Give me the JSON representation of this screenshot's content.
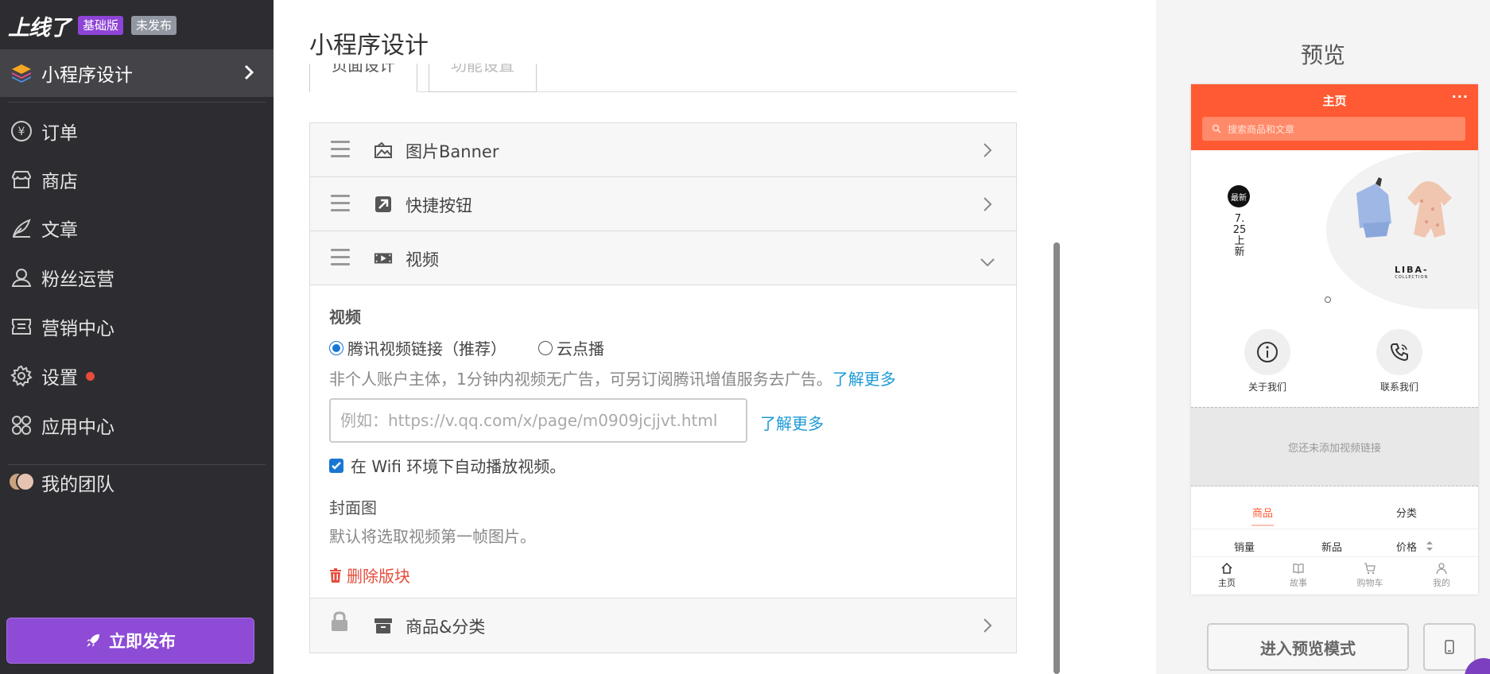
{
  "sidebar": {
    "brand": "上线了",
    "plan_badge": "基础版",
    "status_badge": "未发布",
    "active_item": "小程序设计",
    "items": [
      {
        "label": "订单"
      },
      {
        "label": "商店"
      },
      {
        "label": "文章"
      },
      {
        "label": "粉丝运营"
      },
      {
        "label": "营销中心"
      },
      {
        "label": "设置"
      },
      {
        "label": "应用中心"
      }
    ],
    "team": "我的团队",
    "publish_label": "立即发布"
  },
  "main": {
    "title": "小程序设计",
    "tabs": [
      "页面设计",
      "功能设置"
    ],
    "blocks": {
      "banner": "图片Banner",
      "shortcut": "快捷按钮",
      "video": "视频",
      "products": "商品&分类"
    },
    "video": {
      "section_title": "视频",
      "option_tencent": "腾讯视频链接（推荐）",
      "option_cloud": "云点播",
      "notice": "非个人账户主体，1分钟内视频无广告，可另订阅腾讯增值服务去广告。",
      "learn_more": "了解更多",
      "url_placeholder": "例如：https://v.qq.com/x/page/m0909jcjjvt.html",
      "learn_more_2": "了解更多",
      "autoplay": "在 Wifi 环境下自动播放视频。",
      "cover_title": "封面图",
      "cover_hint": "默认将选取视频第一帧图片。",
      "delete": "删除版块"
    }
  },
  "preview": {
    "title": "预览",
    "phone": {
      "header_title": "主页",
      "more": "···",
      "search_placeholder": "搜索商品和文章",
      "banner_badge": "最新",
      "banner_text": "7.25上新",
      "banner_brand": "LIBA-",
      "banner_brand_sub": "COLLECTION",
      "quick_about": "关于我们",
      "quick_contact": "联系我们",
      "video_placeholder": "您还未添加视频链接",
      "tab_products": "商品",
      "tab_categories": "分类",
      "sort_sales": "销量",
      "sort_new": "新品",
      "sort_price": "价格",
      "bottom_tabs": [
        "主页",
        "故事",
        "购物车",
        "我的"
      ]
    },
    "enter_preview": "进入预览模式"
  },
  "colors": {
    "sidebar_bg": "#2d2d31",
    "brand_purple": "#8e4bd6",
    "phone_header": "#ff5a33",
    "link_blue": "#1e9ad6",
    "danger_red": "#e74c3c"
  }
}
